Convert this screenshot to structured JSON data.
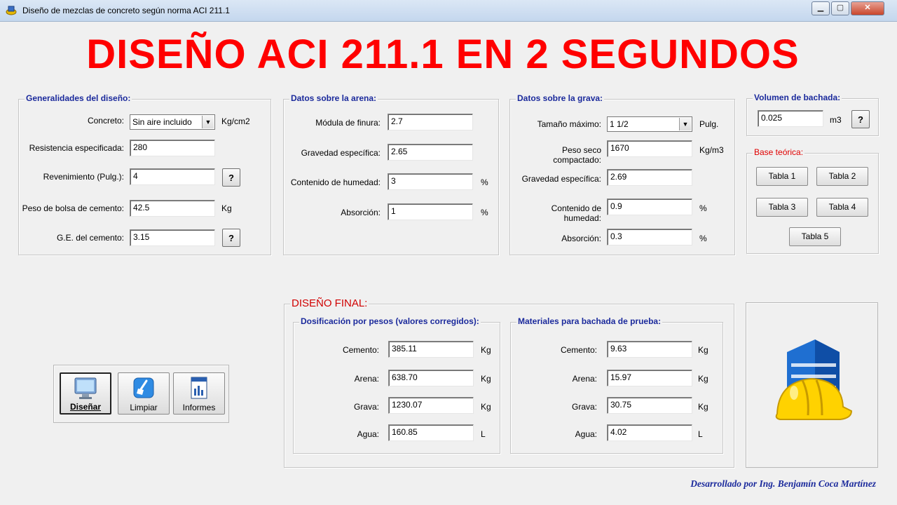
{
  "window": {
    "title": "Diseño de mezclas de concreto según norma ACI 211.1"
  },
  "banner": "DISEÑO ACI 211.1 EN 2 SEGUNDOS",
  "generalidades": {
    "title": "Generalidades del diseño:",
    "concreto_label": "Concreto:",
    "concreto_value": "Sin aire incluido",
    "concreto_unit": "Kg/cm2",
    "resistencia_label": "Resistencia especificada:",
    "resistencia_value": "280",
    "revenimiento_label": "Revenimiento (Pulg.):",
    "revenimiento_value": "4",
    "peso_bolsa_label": "Peso de bolsa de cemento:",
    "peso_bolsa_value": "42.5",
    "peso_bolsa_unit": "Kg",
    "ge_cemento_label": "G.E. del cemento:",
    "ge_cemento_value": "3.15",
    "help_label": "?"
  },
  "arena": {
    "title": "Datos sobre la arena:",
    "modulo_label": "Módula de finura:",
    "modulo_value": "2.7",
    "gravedad_label": "Gravedad específica:",
    "gravedad_value": "2.65",
    "humedad_label": "Contenido de humedad:",
    "humedad_value": "3",
    "humedad_unit": "%",
    "absorcion_label": "Absorción:",
    "absorcion_value": "1",
    "absorcion_unit": "%"
  },
  "grava": {
    "title": "Datos sobre la grava:",
    "tamano_label": "Tamaño máximo:",
    "tamano_value": "1 1/2",
    "tamano_unit": "Pulg.",
    "peso_seco_label": "Peso seco compactado:",
    "peso_seco_value": "1670",
    "peso_seco_unit": "Kg/m3",
    "gravedad_label": "Gravedad específica:",
    "gravedad_value": "2.69",
    "humedad_label": "Contenido de humedad:",
    "humedad_value": "0.9",
    "humedad_unit": "%",
    "absorcion_label": "Absorción:",
    "absorcion_value": "0.3",
    "absorcion_unit": "%"
  },
  "volumen": {
    "title": "Volumen de bachada:",
    "value": "0.025",
    "unit": "m3",
    "help_label": "?"
  },
  "base_teorica": {
    "title": "Base teórica:",
    "buttons": [
      "Tabla 1",
      "Tabla 2",
      "Tabla 3",
      "Tabla 4",
      "Tabla 5"
    ]
  },
  "diseno_final": {
    "title": "DISEÑO FINAL:",
    "dosificacion": {
      "title": "Dosificación por pesos (valores corregidos):",
      "rows": [
        {
          "label": "Cemento:",
          "value": "385.11",
          "unit": "Kg"
        },
        {
          "label": "Arena:",
          "value": "638.70",
          "unit": "Kg"
        },
        {
          "label": "Grava:",
          "value": "1230.07",
          "unit": "Kg"
        },
        {
          "label": "Agua:",
          "value": "160.85",
          "unit": "L"
        }
      ]
    },
    "materiales": {
      "title": "Materiales para bachada de prueba:",
      "rows": [
        {
          "label": "Cemento:",
          "value": "9.63",
          "unit": "Kg"
        },
        {
          "label": "Arena:",
          "value": "15.97",
          "unit": "Kg"
        },
        {
          "label": "Grava:",
          "value": "30.75",
          "unit": "Kg"
        },
        {
          "label": "Agua:",
          "value": "4.02",
          "unit": "L"
        }
      ]
    }
  },
  "actions": {
    "disenar": "Diseñar",
    "limpiar": "Limpiar",
    "informes": "Informes"
  },
  "credit": "Desarrollado por Ing. Benjamín Coca Martínez"
}
